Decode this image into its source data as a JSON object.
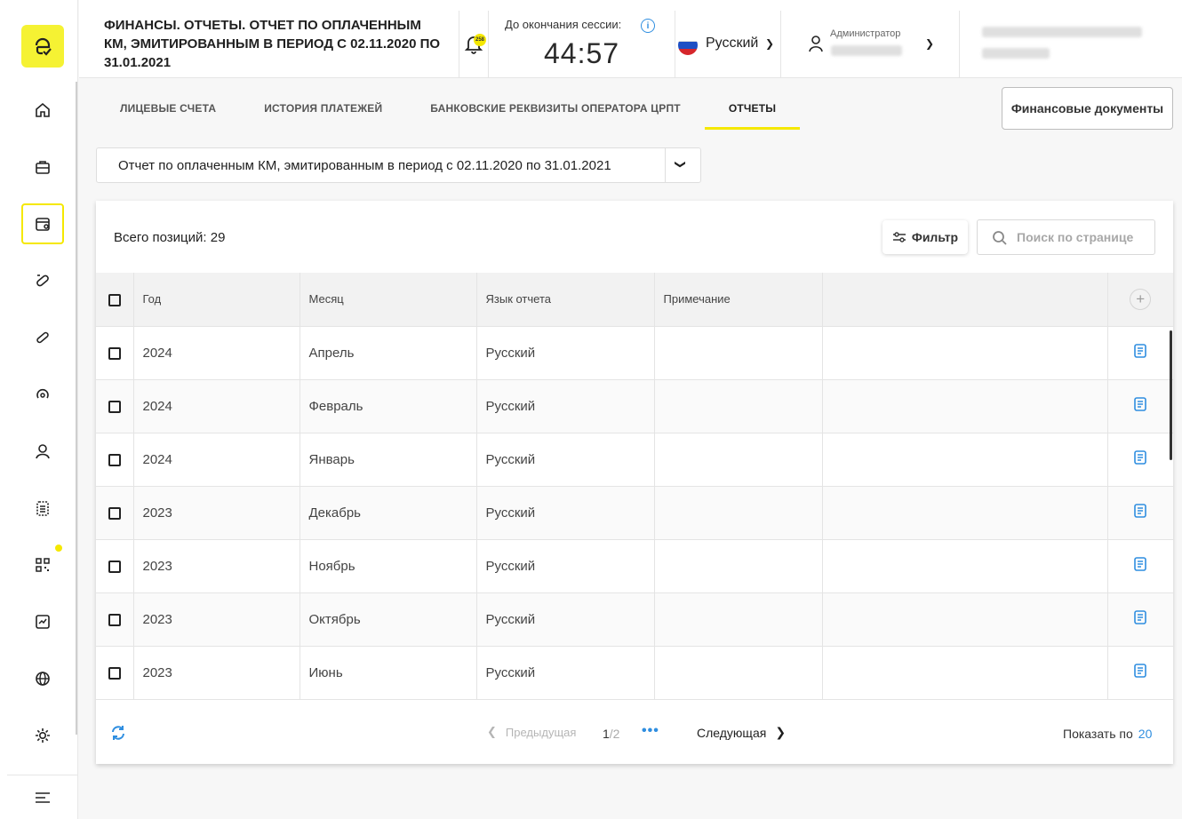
{
  "header": {
    "title": "ФИНАНСЫ. ОТЧЕТЫ. ОТЧЕТ ПО ОПЛАЧЕННЫМ КМ, ЭМИТИРОВАННЫМ В ПЕРИОД С 02.11.2020 ПО 31.01.2021",
    "notifications_count": "258",
    "session_label": "До окончания сессии:",
    "session_timer": "44:57",
    "language": "Русский",
    "role": "Администратор"
  },
  "tabs": [
    {
      "label": "ЛИЦЕВЫЕ СЧЕТА"
    },
    {
      "label": "ИСТОРИЯ ПЛАТЕЖЕЙ"
    },
    {
      "label": "БАНКОВСКИЕ РЕКВИЗИТЫ ОПЕРАТОРА ЦРПТ"
    },
    {
      "label": "ОТЧЕТЫ"
    }
  ],
  "fin_docs_button": "Финансовые документы",
  "report_select": {
    "value": "Отчет по оплаченным КМ, эмитированным в период с 02.11.2020 по 31.01.2021"
  },
  "table_card": {
    "total": "Всего позиций: 29",
    "filter_label": "Фильтр",
    "search_placeholder": "Поиск по странице",
    "columns": [
      "Год",
      "Месяц",
      "Язык отчета",
      "Примечание"
    ],
    "rows": [
      {
        "year": "2024",
        "month": "Апрель",
        "lang": "Русский",
        "note": ""
      },
      {
        "year": "2024",
        "month": "Февраль",
        "lang": "Русский",
        "note": ""
      },
      {
        "year": "2024",
        "month": "Январь",
        "lang": "Русский",
        "note": ""
      },
      {
        "year": "2023",
        "month": "Декабрь",
        "lang": "Русский",
        "note": ""
      },
      {
        "year": "2023",
        "month": "Ноябрь",
        "lang": "Русский",
        "note": ""
      },
      {
        "year": "2023",
        "month": "Октябрь",
        "lang": "Русский",
        "note": ""
      },
      {
        "year": "2023",
        "month": "Июнь",
        "lang": "Русский",
        "note": ""
      }
    ]
  },
  "pagination": {
    "prev": "Предыдущая",
    "current": "1",
    "total": "/2",
    "dots": "•••",
    "next": "Следующая",
    "page_size_label": "Показать по",
    "page_size": "20"
  },
  "colors": {
    "accent": "#f5e800",
    "link": "#2f8ee0"
  }
}
